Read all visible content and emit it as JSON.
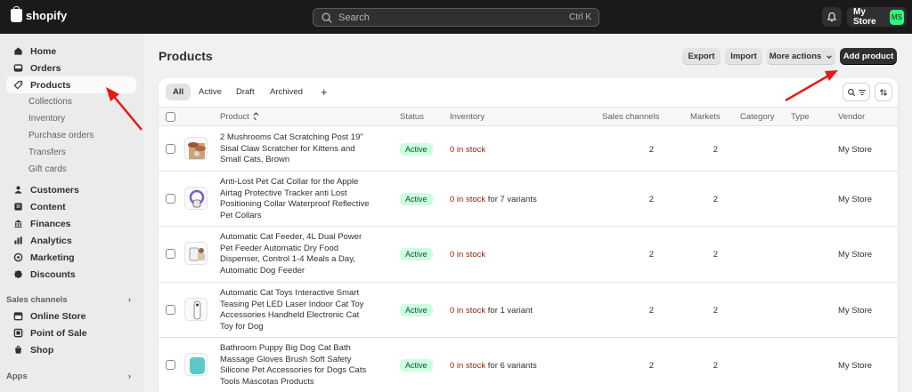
{
  "topbar": {
    "logo_text": "shopify",
    "search_placeholder": "Search",
    "search_shortcut": "Ctrl K",
    "store_name": "My Store",
    "store_initials": "MS"
  },
  "sidebar": {
    "items": [
      {
        "label": "Home",
        "icon": "home-icon"
      },
      {
        "label": "Orders",
        "icon": "orders-icon"
      },
      {
        "label": "Products",
        "icon": "tag-icon",
        "active": true
      }
    ],
    "product_subitems": [
      "Collections",
      "Inventory",
      "Purchase orders",
      "Transfers",
      "Gift cards"
    ],
    "items2": [
      {
        "label": "Customers",
        "icon": "person-icon"
      },
      {
        "label": "Content",
        "icon": "content-icon"
      },
      {
        "label": "Finances",
        "icon": "bank-icon"
      },
      {
        "label": "Analytics",
        "icon": "chart-icon"
      },
      {
        "label": "Marketing",
        "icon": "target-icon"
      },
      {
        "label": "Discounts",
        "icon": "discount-icon"
      }
    ],
    "sales_channels_title": "Sales channels",
    "channels": [
      {
        "label": "Online Store",
        "icon": "store-icon"
      },
      {
        "label": "Point of Sale",
        "icon": "pos-icon"
      },
      {
        "label": "Shop",
        "icon": "shop-icon"
      }
    ],
    "apps_title": "Apps"
  },
  "page": {
    "title": "Products",
    "buttons": {
      "export": "Export",
      "import": "Import",
      "more_actions": "More actions",
      "add_product": "Add product"
    }
  },
  "tabs": [
    "All",
    "Active",
    "Draft",
    "Archived",
    "+"
  ],
  "table": {
    "headers": {
      "product": "Product",
      "status": "Status",
      "inventory": "Inventory",
      "sales_channels": "Sales channels",
      "markets": "Markets",
      "category": "Category",
      "type": "Type",
      "vendor": "Vendor"
    },
    "rows": [
      {
        "title": "2 Mushrooms Cat Scratching Post 19\" Sisal Claw Scratcher for Kittens and Small Cats, Brown",
        "status": "Active",
        "inventory_oos": "0 in stock",
        "inventory_suffix": "",
        "sales_channels": "2",
        "markets": "2",
        "vendor": "My Store"
      },
      {
        "title": "Anti-Lost Pet Cat Collar for the Apple Airtag Protective Tracker anti Lost Positioning Collar Waterproof Reflective Pet Collars",
        "status": "Active",
        "inventory_oos": "0 in stock",
        "inventory_suffix": " for 7 variants",
        "sales_channels": "2",
        "markets": "2",
        "vendor": "My Store"
      },
      {
        "title": "Automatic Cat Feeder, 4L Dual Power Pet Feeder Automatic Dry Food Dispenser, Control 1-4 Meals a Day, Automatic Dog Feeder",
        "status": "Active",
        "inventory_oos": "0 in stock",
        "inventory_suffix": "",
        "sales_channels": "2",
        "markets": "2",
        "vendor": "My Store"
      },
      {
        "title": "Automatic Cat Toys Interactive Smart Teasing Pet LED Laser Indoor Cat Toy Accessories Handheld Electronic Cat Toy for Dog",
        "status": "Active",
        "inventory_oos": "0 in stock",
        "inventory_suffix": " for 1 variant",
        "sales_channels": "2",
        "markets": "2",
        "vendor": "My Store"
      },
      {
        "title": "Bathroom Puppy Big Dog Cat Bath Massage Gloves Brush Soft Safety Silicone Pet Accessories for Dogs Cats Tools Mascotas Products",
        "status": "Active",
        "inventory_oos": "0 in stock",
        "inventory_suffix": " for 6 variants",
        "sales_channels": "2",
        "markets": "2",
        "vendor": "My Store"
      }
    ]
  },
  "colors": {
    "topbar": "#1a1a1a",
    "active_badge_bg": "#cdfee1",
    "out_of_stock": "#8e1f0b",
    "annotation_arrow": "#e21b1b"
  }
}
